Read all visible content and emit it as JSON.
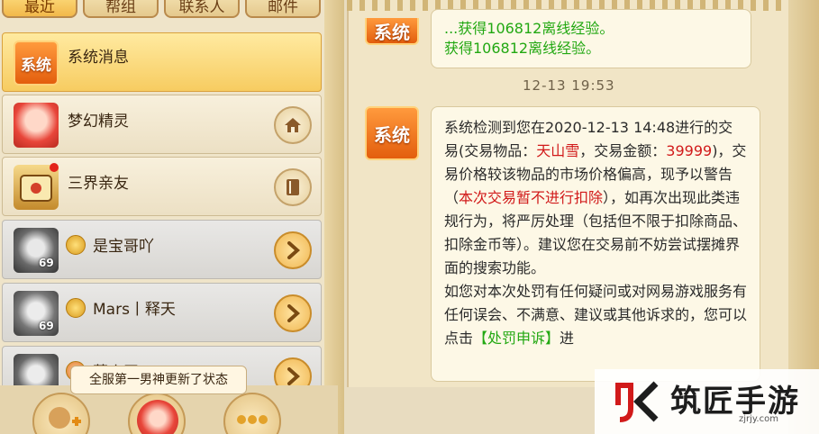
{
  "tabs": [
    {
      "label": "最近",
      "active": true
    },
    {
      "label": "帮组"
    },
    {
      "label": "联系人"
    },
    {
      "label": "邮件"
    }
  ],
  "contacts": [
    {
      "name": "系统消息",
      "type": "system",
      "selected": true
    },
    {
      "name": "梦幻精灵",
      "button": "home-icon"
    },
    {
      "name": "三界亲友",
      "button": "book-icon"
    },
    {
      "name": "是宝哥吖",
      "level": "69",
      "button": "arrow-right-icon"
    },
    {
      "name": "Mars丨释天",
      "level": "69",
      "button": "arrow-right-icon"
    },
    {
      "name": "莫小玉",
      "button": "arrow-right-icon"
    }
  ],
  "tooltip": "全服第一男神更新了状态",
  "chat": {
    "system_avatar_label": "系统",
    "prev_message_line1": "...获得106812离线经验。",
    "prev_message_text": "获得106812离线经验。",
    "timestamp": "12-13 19:53",
    "message": {
      "p1": "系统检测到您在2020-12-13 14:48进行的交易(交易物品：",
      "item": "天山雪",
      "p2": "，交易金额：",
      "amount": "39999",
      "p3": ")，交易价格较该物品的市场价格偏高，现予以警告（",
      "warning": "本次交易暂不进行扣除",
      "p4": "），如再次出现此类违规行为，将严厉处理（包括但不限于扣除商品、扣除金币等）。建议您在交易前不妨尝试摆摊界面的搜索功能。",
      "p5": "如您对本次处罚有任何疑问或对网易游戏服务有任何误会、不满意、建议或其他诉求的，您可以点击",
      "link": "【处罚申诉】",
      "p6": "进"
    }
  },
  "watermark": {
    "brand": "筑匠手游",
    "url": "zjrjy.com"
  },
  "colors": {
    "accent": "#f7cc61",
    "red": "#d11a1a",
    "green": "#22a812"
  }
}
